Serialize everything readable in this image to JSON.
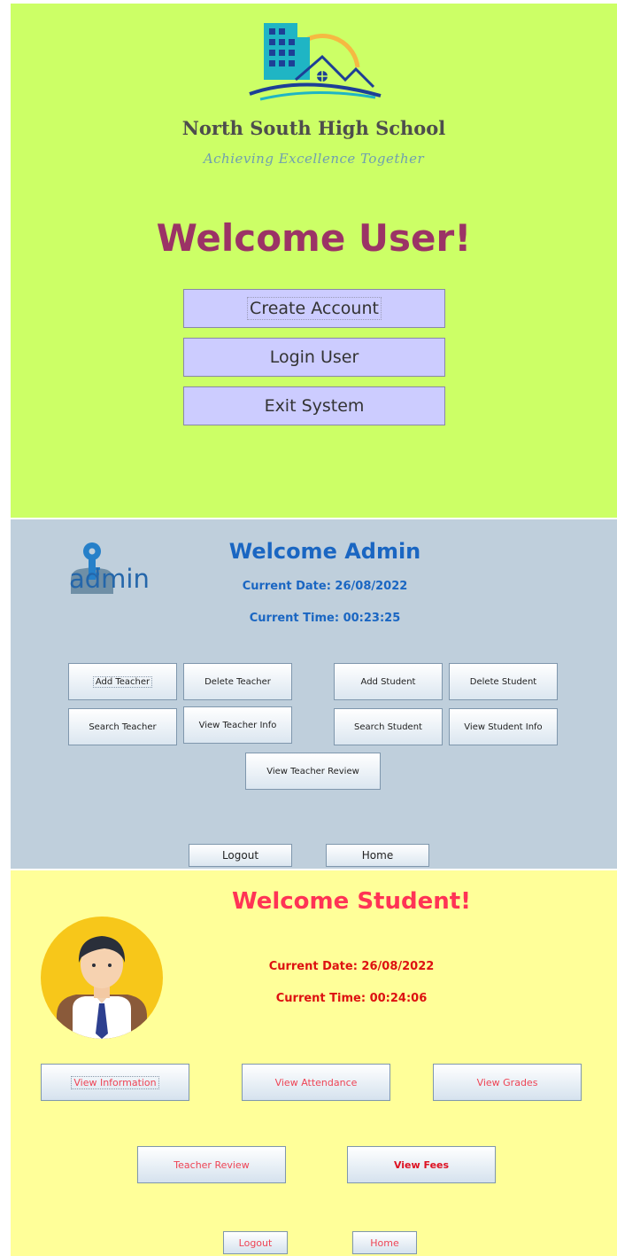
{
  "welcome_panel": {
    "school_name": "North South High School",
    "motto": "Achieving Excellence Together",
    "heading": "Welcome User!",
    "buttons": {
      "create_account": "Create Account",
      "login_user": "Login User",
      "exit_system": "Exit System"
    },
    "colors": {
      "background": "#ccff66",
      "heading": "#9b3366",
      "button": "#ccccff"
    }
  },
  "admin_panel": {
    "icon_text": "admin",
    "heading": "Welcome Admin",
    "date_label": "Current Date: 26/08/2022",
    "time_label": "Current Time: 00:23:25",
    "buttons": {
      "add_teacher": "Add Teacher",
      "delete_teacher": "Delete Teacher",
      "add_student": "Add Student",
      "delete_student": "Delete Student",
      "search_teacher": "Search Teacher",
      "view_teacher_info": "View Teacher Info",
      "search_student": "Search Student",
      "view_student_info": "View Student Info",
      "view_teacher_review": "View Teacher Review",
      "logout": "Logout",
      "home": "Home"
    },
    "colors": {
      "background": "#bfcfdc",
      "accent": "#1a66c2"
    }
  },
  "student_panel": {
    "heading": "Welcome Student!",
    "date_label": "Current Date: 26/08/2022",
    "time_label": "Current Time: 00:24:06",
    "buttons": {
      "view_information": "View Information",
      "view_attendance": "View Attendance",
      "view_grades": "View Grades",
      "teacher_review": "Teacher Review",
      "view_fees": "View Fees",
      "logout": "Logout",
      "home": "Home"
    },
    "colors": {
      "background": "#ffff99",
      "heading": "#ff3355",
      "info": "#dd1111"
    }
  },
  "icons": [
    "school-building-logo",
    "admin-key-icon",
    "student-avatar-icon"
  ]
}
